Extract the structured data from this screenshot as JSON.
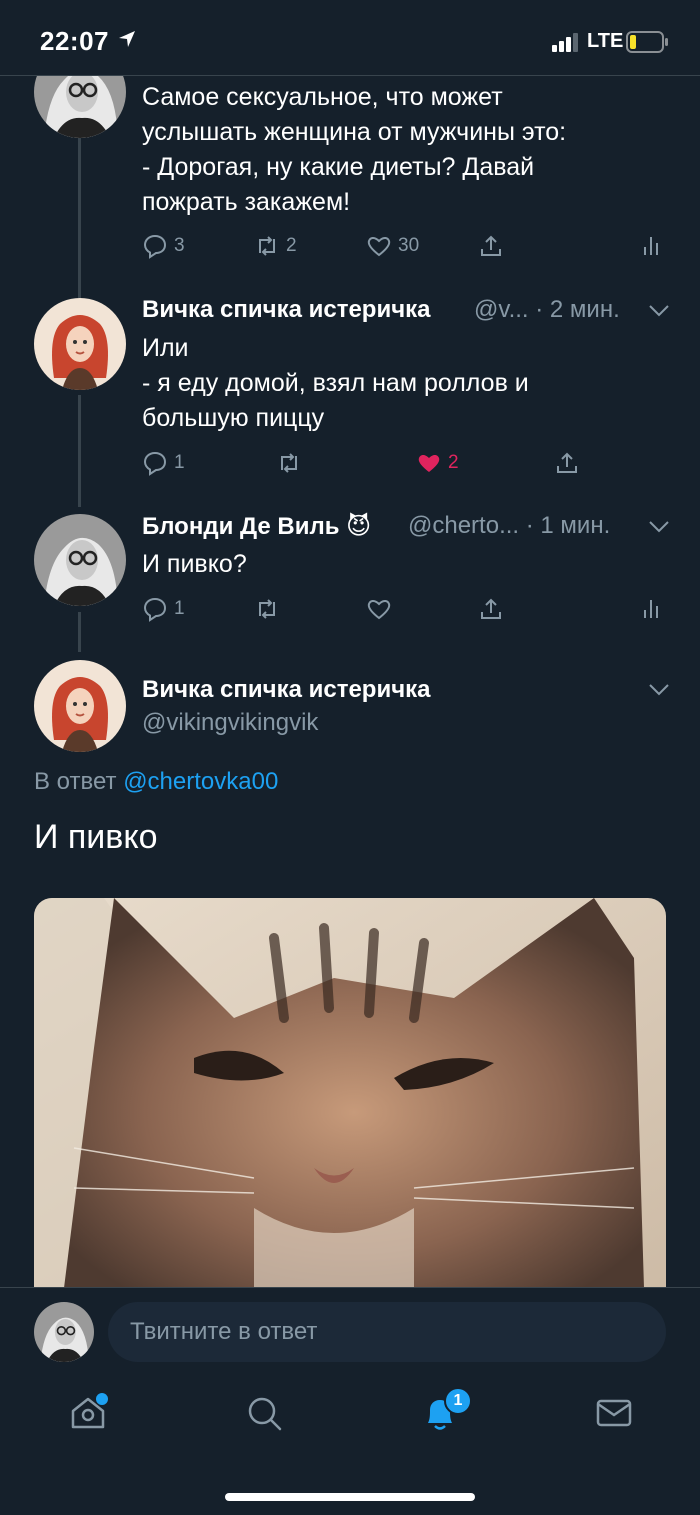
{
  "status_bar": {
    "time": "22:07",
    "network": "LTE",
    "battery_level": 0.2
  },
  "tweets": [
    {
      "text_lines": [
        "Самое сексуальное, что может",
        "услышать женщина от мужчины это:",
        "- Дорогая, ну какие диеты? Давай",
        "пожрать закажем!"
      ],
      "replies": "3",
      "retweets": "2",
      "likes": "30"
    },
    {
      "name": "Вичка спичка истеричка",
      "handle_time": "@v... · 2 мин.",
      "text_lines": [
        "Или",
        "- я еду домой, взял нам роллов и",
        "большую пиццу"
      ],
      "replies": "1",
      "likes": "2",
      "liked": true
    },
    {
      "name": "Блонди Де Виль",
      "emoji": "😈",
      "handle_time": "@cherto... · 1 мин.",
      "text_lines": [
        "И пивко?"
      ],
      "replies": "1"
    }
  ],
  "focused_tweet": {
    "name": "Вичка спичка истеричка",
    "handle": "@vikingvikingvik",
    "reply_prefix": "В ответ",
    "reply_to": "@chertovka00",
    "text": "И пивко"
  },
  "reply_bar": {
    "placeholder": "Твитните в ответ"
  },
  "tabbar": {
    "notifications_badge": "1"
  },
  "colors": {
    "background": "#15202b",
    "accent": "#1da1f2",
    "like": "#e0245e",
    "muted": "#8899a6"
  }
}
